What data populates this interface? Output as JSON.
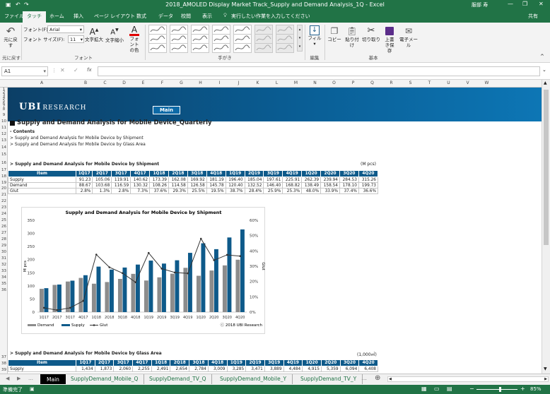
{
  "window": {
    "title": "2018_AMOLED Display Market Track_Supply and Demand Analysis_1Q  -  Excel",
    "user": "服部 寿",
    "controls": [
      "—",
      "❐",
      "✕"
    ]
  },
  "tabs": [
    "ファイル",
    "タッチ",
    "ホーム",
    "挿入",
    "ページ レイアウト",
    "数式",
    "データ",
    "校閲",
    "表示"
  ],
  "tell_me": "実行したい作業を入力してください",
  "share": "共有",
  "ribbon": {
    "undo": "元に戻す",
    "undo_group": "元に戻す",
    "font_label": "フォント(F):",
    "font_value": "Arial",
    "size_label": "フォント サイズ(F):",
    "size_value": "11",
    "grow": "文字拡大",
    "shrink": "文字縮小",
    "font_color": "フォントの色",
    "font_group": "フォント",
    "ink_group": "手がき",
    "fill": "フィル",
    "edit_group": "編集",
    "copy": "コピー",
    "paste": "貼り付け",
    "cut": "切り取り",
    "save": "上書き保存",
    "email": "電子メール",
    "basic_group": "基本"
  },
  "formula": {
    "namebox": "A1",
    "fx": "fx",
    "value": ""
  },
  "columns": [
    "A",
    "B",
    "C",
    "D",
    "E",
    "F",
    "G",
    "H",
    "I",
    "J",
    "K",
    "L",
    "M",
    "N",
    "O",
    "P",
    "Q",
    "R",
    "S",
    "T",
    "U",
    "V",
    "W"
  ],
  "rows": [
    "1",
    "2",
    "3",
    "4",
    "5",
    "6",
    "7",
    "8",
    "9",
    "10",
    "11",
    "12",
    "13",
    "14",
    "15",
    "16",
    "17",
    "18",
    "19",
    "20",
    "21",
    "22",
    "23",
    "24",
    "25",
    "26",
    "27",
    "28",
    "29",
    "30",
    "31",
    "32",
    "33",
    "34",
    "35",
    "36",
    "37",
    "38",
    "39"
  ],
  "banner": {
    "logo": "UBI",
    "logo_sub": "RESEARCH",
    "main_button": "Main"
  },
  "content": {
    "heading": "Supply and Demand Analysis for Mobile Device_Quarterly",
    "contents_label": "- Contents",
    "item1": "> Supply and Demand Analysis for Mobile Device by Shipment",
    "item2": "> Supply and Demand Analysis for Mobile Device by Glass Area",
    "section1": "> Supply and Demand Analysis for Mobile Device by Shipment",
    "unit1": "(M pcs)",
    "section2": "> Supply and Demand Analysis for Mobile Device by Glass Area",
    "unit2": "(1,000㎡)"
  },
  "table1": {
    "header": [
      "Item",
      "1Q17",
      "2Q17",
      "3Q17",
      "4Q17",
      "1Q18",
      "2Q18",
      "3Q18",
      "4Q18",
      "1Q19",
      "2Q19",
      "3Q19",
      "4Q19",
      "1Q20",
      "2Q20",
      "3Q20",
      "4Q20"
    ],
    "rows": [
      [
        "Supply",
        "91.23",
        "105.06",
        "119.91",
        "140.62",
        "173.39",
        "162.08",
        "169.92",
        "181.19",
        "196.40",
        "185.04",
        "197.61",
        "225.91",
        "262.39",
        "239.94",
        "284.53",
        "315.26"
      ],
      [
        "Demand",
        "88.67",
        "103.68",
        "116.59",
        "130.32",
        "108.26",
        "114.58",
        "126.58",
        "145.78",
        "120.40",
        "132.52",
        "146.40",
        "168.82",
        "138.49",
        "158.54",
        "178.10",
        "199.73"
      ],
      [
        "Glut",
        "2.8%",
        "1.3%",
        "2.8%",
        "7.3%",
        "37.6%",
        "29.3%",
        "25.5%",
        "19.5%",
        "38.7%",
        "28.4%",
        "25.9%",
        "25.3%",
        "48.0%",
        "33.9%",
        "37.4%",
        "36.6%"
      ]
    ]
  },
  "table2": {
    "header": [
      "Item",
      "1Q17",
      "2Q17",
      "3Q17",
      "4Q17",
      "1Q18",
      "2Q18",
      "3Q18",
      "4Q18",
      "1Q19",
      "2Q19",
      "3Q19",
      "4Q19",
      "1Q20",
      "2Q20",
      "3Q20",
      "4Q20"
    ],
    "rows": [
      [
        "Supply",
        "1,434",
        "1,873",
        "2,060",
        "2,255",
        "2,491",
        "2,654",
        "2,784",
        "3,009",
        "3,285",
        "3,471",
        "3,889",
        "4,484",
        "4,915",
        "5,359",
        "6,094",
        "6,408"
      ]
    ]
  },
  "chart_data": {
    "type": "bar",
    "title": "Supply and Demand Analysis for Mobile Device by Shipment",
    "categories": [
      "1Q17",
      "2Q17",
      "3Q17",
      "4Q17",
      "1Q18",
      "2Q18",
      "3Q18",
      "4Q18",
      "1Q19",
      "2Q19",
      "3Q19",
      "4Q19",
      "1Q20",
      "2Q20",
      "3Q20",
      "4Q20"
    ],
    "series": [
      {
        "name": "Demand",
        "type": "bar",
        "color": "#8c8c8c",
        "values": [
          88.67,
          103.68,
          116.59,
          130.32,
          108.26,
          114.58,
          126.58,
          145.78,
          120.4,
          132.52,
          146.4,
          168.82,
          138.49,
          158.54,
          178.1,
          199.73
        ]
      },
      {
        "name": "Supply",
        "type": "bar",
        "color": "#0e5a8a",
        "values": [
          91.23,
          105.06,
          119.91,
          140.62,
          173.39,
          162.08,
          169.92,
          181.19,
          196.4,
          185.04,
          197.61,
          225.91,
          262.39,
          239.94,
          284.53,
          315.26
        ]
      },
      {
        "name": "Glut",
        "type": "line",
        "axis": "right",
        "color": "#333333",
        "values": [
          2.8,
          1.3,
          2.8,
          7.3,
          37.6,
          29.3,
          25.5,
          19.5,
          38.7,
          28.4,
          25.9,
          25.3,
          48.0,
          33.9,
          37.4,
          36.6
        ]
      }
    ],
    "ylabel": "M pcs",
    "y2label": "Glut",
    "ylim": [
      0,
      350
    ],
    "yticks": [
      "0",
      "50",
      "100",
      "150",
      "200",
      "250",
      "300",
      "350"
    ],
    "y2lim": [
      0,
      60
    ],
    "y2ticks": [
      "0%",
      "10%",
      "20%",
      "30%",
      "40%",
      "50%",
      "60%"
    ],
    "legend": "bottom-left",
    "grid": false,
    "annotation": "ⓒ 2018 UBI Research"
  },
  "sheets": [
    {
      "name": "Main",
      "active": true
    },
    {
      "name": "SupplyDemand_Mobile_Q"
    },
    {
      "name": "SupplyDemand_TV_Q"
    },
    {
      "name": "SupplyDemand_Mobile_Y"
    },
    {
      "name": "SupplyDemand_TV_Y"
    }
  ],
  "status": {
    "ready": "準備完了",
    "zoom": "85%"
  }
}
